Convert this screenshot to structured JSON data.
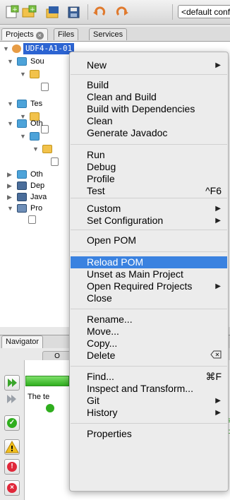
{
  "toolbar": {
    "config_combo": "<default config>",
    "icons": [
      "new-file-icon",
      "new-project-icon",
      "open-project-icon",
      "save-all-icon",
      "undo-icon",
      "redo-icon"
    ]
  },
  "project_tabs": {
    "projects": "Projects",
    "files": "Files",
    "services": "Services"
  },
  "tree": {
    "root": "UDF4-A1-01",
    "labels": {
      "sources": "Sou",
      "test": "Tes",
      "other1": "Oth",
      "other2": "Oth",
      "deps": "Dep",
      "java": "Java",
      "project_files": "Pro"
    }
  },
  "navigator": {
    "tab": "Navigator",
    "tab2_label": "O",
    "results_text": "The te",
    "row_letter": "s",
    "row_letter2": "p"
  },
  "menu": {
    "items": [
      {
        "label": "New",
        "submenu": true
      },
      {
        "label": "Build"
      },
      {
        "label": "Clean and Build"
      },
      {
        "label": "Build with Dependencies"
      },
      {
        "label": "Clean"
      },
      {
        "label": "Generate Javadoc"
      },
      {
        "label": "Run"
      },
      {
        "label": "Debug"
      },
      {
        "label": "Profile"
      },
      {
        "label": "Test",
        "shortcut": "^F6"
      },
      {
        "label": "Custom",
        "submenu": true
      },
      {
        "label": "Set Configuration",
        "submenu": true
      },
      {
        "label": "Open POM"
      },
      {
        "label": "Reload POM",
        "highlighted": true
      },
      {
        "label": "Unset as Main Project"
      },
      {
        "label": "Open Required Projects",
        "submenu": true
      },
      {
        "label": "Close"
      },
      {
        "label": "Rename..."
      },
      {
        "label": "Move..."
      },
      {
        "label": "Copy..."
      },
      {
        "label": "Delete",
        "shortcut_icon": "delete-key-icon"
      },
      {
        "label": "Find...",
        "shortcut": "⌘F"
      },
      {
        "label": "Inspect and Transform..."
      },
      {
        "label": "Git",
        "submenu": true
      },
      {
        "label": "History",
        "submenu": true
      },
      {
        "label": "Properties"
      }
    ],
    "highlight_color": "#3a82e0"
  },
  "colors": {
    "selection": "#2c64d2",
    "progress_green": "#2fae1e"
  }
}
